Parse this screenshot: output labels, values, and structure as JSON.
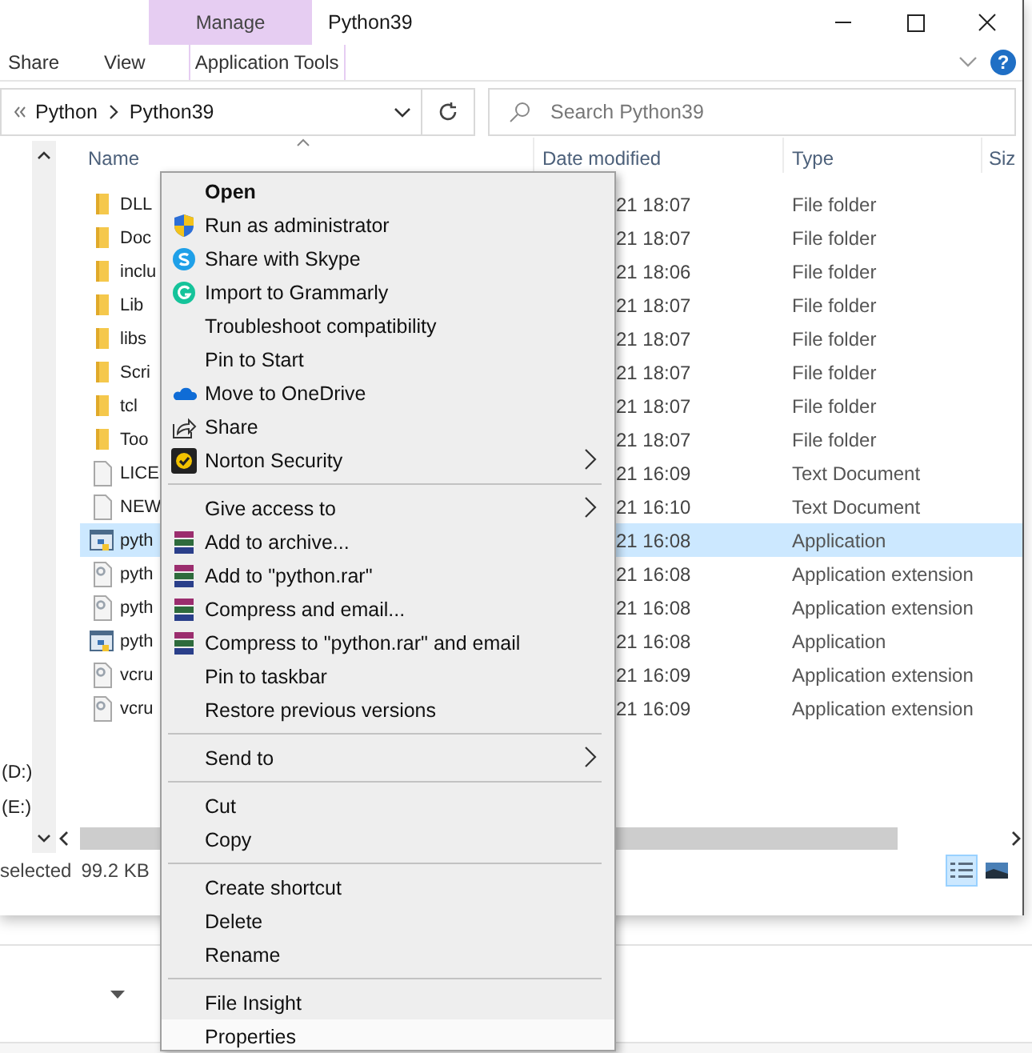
{
  "window": {
    "title": "Python39",
    "context_group": "Manage",
    "help": "?"
  },
  "ribbon_tabs": [
    {
      "label": "Share",
      "selected": false,
      "contextual": false
    },
    {
      "label": "View",
      "selected": false,
      "contextual": false
    },
    {
      "label": "Application Tools",
      "selected": false,
      "contextual": true
    }
  ],
  "address": {
    "path": [
      "Python",
      "Python39"
    ]
  },
  "search": {
    "placeholder": "Search Python39"
  },
  "columns": [
    {
      "label": "Name",
      "sorted": true
    },
    {
      "label": "Date modified",
      "sorted": false
    },
    {
      "label": "Type",
      "sorted": false
    },
    {
      "label": "Siz",
      "sorted": false
    }
  ],
  "navigation": [
    {
      "label": "(D:)"
    },
    {
      "label": "(E:)"
    }
  ],
  "files": [
    {
      "name": "DLL",
      "modified": "21 18:07",
      "type": "File folder",
      "kind": "folder",
      "selected": false
    },
    {
      "name": "Doc",
      "modified": "21 18:07",
      "type": "File folder",
      "kind": "folder",
      "selected": false
    },
    {
      "name": "inclu",
      "modified": "21 18:06",
      "type": "File folder",
      "kind": "folder",
      "selected": false
    },
    {
      "name": "Lib",
      "modified": "21 18:07",
      "type": "File folder",
      "kind": "folder",
      "selected": false
    },
    {
      "name": "libs",
      "modified": "21 18:07",
      "type": "File folder",
      "kind": "folder",
      "selected": false
    },
    {
      "name": "Scri",
      "modified": "21 18:07",
      "type": "File folder",
      "kind": "folder",
      "selected": false
    },
    {
      "name": "tcl",
      "modified": "21 18:07",
      "type": "File folder",
      "kind": "folder",
      "selected": false
    },
    {
      "name": "Too",
      "modified": "21 18:07",
      "type": "File folder",
      "kind": "folder",
      "selected": false
    },
    {
      "name": "LICE",
      "modified": "21 16:09",
      "type": "Text Document",
      "kind": "text",
      "selected": false
    },
    {
      "name": "NEW",
      "modified": "21 16:10",
      "type": "Text Document",
      "kind": "text",
      "selected": false
    },
    {
      "name": "pyth",
      "modified": "21 16:08",
      "type": "Application",
      "kind": "app",
      "selected": true
    },
    {
      "name": "pyth",
      "modified": "21 16:08",
      "type": "Application extension",
      "kind": "extension",
      "selected": false
    },
    {
      "name": "pyth",
      "modified": "21 16:08",
      "type": "Application extension",
      "kind": "extension",
      "selected": false
    },
    {
      "name": "pyth",
      "modified": "21 16:08",
      "type": "Application",
      "kind": "app",
      "selected": false
    },
    {
      "name": "vcru",
      "modified": "21 16:09",
      "type": "Application extension",
      "kind": "extension",
      "selected": false
    },
    {
      "name": "vcru",
      "modified": "21 16:09",
      "type": "Application extension",
      "kind": "extension",
      "selected": false
    }
  ],
  "status": {
    "selection": "selected",
    "size": "99.2 KB",
    "views": [
      {
        "kind": "details",
        "selected": true
      },
      {
        "kind": "tiles",
        "selected": false
      }
    ]
  },
  "context_menu": {
    "groups": [
      [
        {
          "label": "Open",
          "kind": "plain",
          "default": true,
          "submenu": false,
          "selected": false
        },
        {
          "label": "Run as administrator",
          "kind": "shield",
          "default": false,
          "submenu": false,
          "selected": false
        },
        {
          "label": "Share with Skype",
          "kind": "skype",
          "default": false,
          "submenu": false,
          "selected": false
        },
        {
          "label": "Import to Grammarly",
          "kind": "grammarly",
          "default": false,
          "submenu": false,
          "selected": false
        },
        {
          "label": "Troubleshoot compatibility",
          "kind": "plain",
          "default": false,
          "submenu": false,
          "selected": false
        },
        {
          "label": "Pin to Start",
          "kind": "plain",
          "default": false,
          "submenu": false,
          "selected": false
        },
        {
          "label": "Move to OneDrive",
          "kind": "onedrive",
          "default": false,
          "submenu": false,
          "selected": false
        },
        {
          "label": "Share",
          "kind": "share",
          "default": false,
          "submenu": false,
          "selected": false
        },
        {
          "label": "Norton Security",
          "kind": "norton",
          "default": false,
          "submenu": true,
          "selected": false
        }
      ],
      [
        {
          "label": "Give access to",
          "kind": "plain",
          "default": false,
          "submenu": true,
          "selected": false
        },
        {
          "label": "Add to archive...",
          "kind": "archive",
          "default": false,
          "submenu": false,
          "selected": false
        },
        {
          "label": "Add to \"python.rar\"",
          "kind": "archive",
          "default": false,
          "submenu": false,
          "selected": false
        },
        {
          "label": "Compress and email...",
          "kind": "archive",
          "default": false,
          "submenu": false,
          "selected": false
        },
        {
          "label": "Compress to \"python.rar\" and email",
          "kind": "archive",
          "default": false,
          "submenu": false,
          "selected": false
        },
        {
          "label": "Pin to taskbar",
          "kind": "plain",
          "default": false,
          "submenu": false,
          "selected": false
        },
        {
          "label": "Restore previous versions",
          "kind": "plain",
          "default": false,
          "submenu": false,
          "selected": false
        }
      ],
      [
        {
          "label": "Send to",
          "kind": "plain",
          "default": false,
          "submenu": true,
          "selected": false
        }
      ],
      [
        {
          "label": "Cut",
          "kind": "plain",
          "default": false,
          "submenu": false,
          "selected": false
        },
        {
          "label": "Copy",
          "kind": "plain",
          "default": false,
          "submenu": false,
          "selected": false
        }
      ],
      [
        {
          "label": "Create shortcut",
          "kind": "plain",
          "default": false,
          "submenu": false,
          "selected": false
        },
        {
          "label": "Delete",
          "kind": "plain",
          "default": false,
          "submenu": false,
          "selected": false
        },
        {
          "label": "Rename",
          "kind": "plain",
          "default": false,
          "submenu": false,
          "selected": false
        }
      ],
      [
        {
          "label": "File Insight",
          "kind": "plain",
          "default": false,
          "submenu": false,
          "selected": false
        },
        {
          "label": "Properties",
          "kind": "plain",
          "default": false,
          "submenu": false,
          "selected": true
        }
      ]
    ]
  }
}
